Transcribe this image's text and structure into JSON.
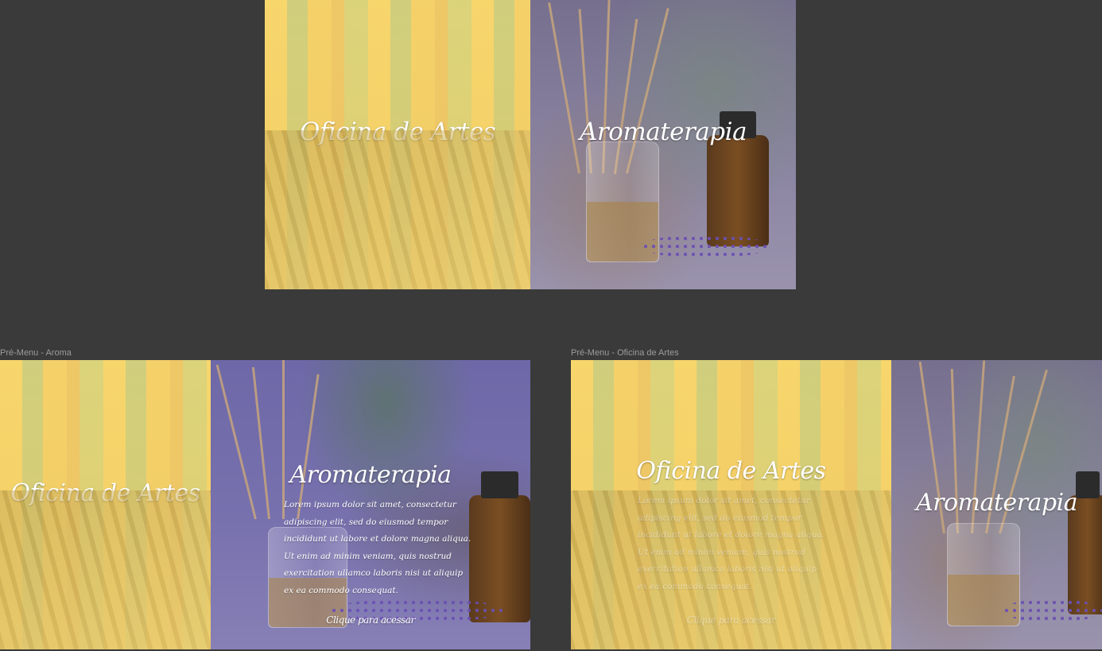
{
  "canvas": {
    "background": "#3a3a3a"
  },
  "frames": [
    {
      "label": "",
      "art": {
        "title": "Oficina de Artes"
      },
      "aroma": {
        "title": "Aromaterapia"
      }
    },
    {
      "label": "Pré-Menu - Aroma",
      "art": {
        "title": "Oficina de Artes"
      },
      "aroma": {
        "title": "Aromaterapia",
        "description": "Lorem ipsum dolor sit amet, consectetur adipiscing elit, sed do eiusmod tempor incididunt ut labore et dolore magna aliqua. Ut enim ad minim veniam, quis nostrud exercitation ullamco laboris nisi ut aliquip ex ea commodo consequat.",
        "cta": "Clique para acessar"
      }
    },
    {
      "label": "Pré-Menu - Oficina de Artes",
      "art": {
        "title": "Oficina de Artes",
        "description": "Lorem ipsum dolor sit amet, consectetur adipiscing elit, sed do eiusmod tempor incididunt ut labore et dolore magna aliqua. Ut enim ad minim veniam, quis nostrud exercitation ullamco laboris nisi ut aliquip ex ea commodo consequat.",
        "cta": "Clique para acessar"
      },
      "aroma": {
        "title": "Aromaterapia"
      }
    }
  ],
  "colors": {
    "art_overlay": "#f6d46a",
    "aroma_overlay": "#7771ae",
    "frame_label": "#9c9c9c"
  }
}
